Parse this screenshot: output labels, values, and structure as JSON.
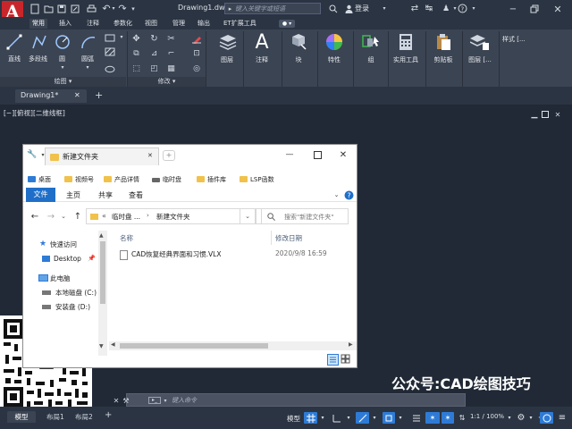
{
  "app": {
    "logo_letter": "A",
    "file_title": "Drawing1.dwg",
    "search_placeholder": "键入关键字或短语",
    "login_label": "登录",
    "colors": {
      "brand": "#c8262b",
      "accent": "#2e7bd6",
      "ribbon": "#3b4453"
    }
  },
  "ribbon_tabs": [
    "常用",
    "插入",
    "注释",
    "参数化",
    "视图",
    "管理",
    "输出",
    "ET扩展工具"
  ],
  "home_panel": {
    "draw_tools": [
      "直线",
      "多段线",
      "圆",
      "圆弧"
    ],
    "draw_footer": "绘图",
    "modify_footer": "修改",
    "big_buttons": [
      "图层",
      "注释",
      "块",
      "特性",
      "组",
      "实用工具",
      "剪贴板",
      "图层 [..."
    ],
    "style_label": "样式 [..."
  },
  "doc_tab": {
    "label": "Drawing1*",
    "add": "+"
  },
  "viewport_label": "[−][俯视][二维线框]",
  "explorer": {
    "tab_title": "新建文件夹",
    "quick_access": [
      "桌面",
      "视频号",
      "产品详情",
      "临时盘",
      "插件库",
      "LSP函数"
    ],
    "menu": [
      "文件",
      "主页",
      "共享",
      "查看"
    ],
    "breadcrumb": [
      "临时盘 ...",
      "新建文件夹"
    ],
    "breadcrumb_prefix": "«",
    "search_placeholder": "搜索\"新建文件夹\"",
    "nav": [
      {
        "label": "快速访问",
        "icon": "star-icon"
      },
      {
        "label": "Desktop",
        "icon": "desktop-icon"
      },
      {
        "label": "此电脑",
        "icon": "computer-icon"
      },
      {
        "label": "本地磁盘 (C:)",
        "icon": "drive-icon"
      },
      {
        "label": "安装盘 (D:)",
        "icon": "drive-icon"
      }
    ],
    "columns": [
      "名称",
      "修改日期"
    ],
    "files": [
      {
        "name": "CAD恢复经典界面和习惯.VLX",
        "date": "2020/9/8 16:59"
      }
    ]
  },
  "watermark": "公众号:CAD绘图技巧",
  "command": {
    "placeholder": "键入命令"
  },
  "layout_tabs": [
    "模型",
    "布局1",
    "布局2"
  ],
  "status": {
    "model_label": "模型",
    "scale": "1:1 / 100%"
  }
}
